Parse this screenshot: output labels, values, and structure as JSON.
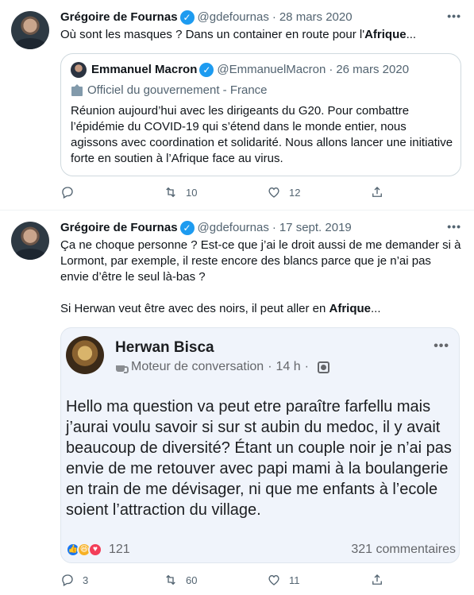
{
  "colors": {
    "accent": "#1d9bf0",
    "muted": "#536471",
    "border": "#cfd9de",
    "fb_card_bg": "#f0f4fb"
  },
  "tweet1": {
    "author_name": "Grégoire de Fournas",
    "handle": "@gdefournas",
    "separator": "·",
    "date": "28 mars 2020",
    "text_prefix": "Où sont les masques ? Dans un container en route pour l'",
    "text_bold": "Afrique",
    "text_suffix": "...",
    "quote": {
      "author_name": "Emmanuel Macron",
      "handle": "@EmmanuelMacron",
      "separator": "·",
      "date": "26 mars 2020",
      "label": "Officiel du gouvernement - France",
      "text": "Réunion aujourd’hui avec les dirigeants du G20. Pour combattre l’épidémie du COVID-19 qui s’étend dans le monde entier, nous agissons avec coordination et solidarité. Nous allons lancer une initiative forte en soutien à l’Afrique face au virus."
    },
    "actions": {
      "replies": "",
      "retweets": "10",
      "likes": "12"
    }
  },
  "tweet2": {
    "author_name": "Grégoire de Fournas",
    "handle": "@gdefournas",
    "separator": "·",
    "date": "17 sept. 2019",
    "text_p1": "Ça ne choque personne ? Est-ce que j’ai le droit aussi de me demander si à Lormont, par exemple, il reste encore des blancs parce que je n’ai pas envie d’être le seul là-bas ?",
    "text_p2_prefix": "Si Herwan veut être avec des noirs, il peut aller en ",
    "text_p2_bold": "Afrique",
    "text_p2_suffix": "...",
    "embed": {
      "author_name": "Herwan Bisca",
      "group": "Moteur de conversation",
      "separator": "·",
      "time": "14 h",
      "separator2": "·",
      "body": "Hello ma question va peut etre paraître farfellu mais j’aurai voulu savoir si sur st aubin du medoc, il y avait beaucoup de diversité? Étant un couple noir je n’ai pas envie de me retouver avec papi mami à la boulangerie en train de me dévisager, ni que me enfants à l’ecole soient l’attraction du village.",
      "reactions_count": "121",
      "comments": "321 commentaires"
    },
    "actions": {
      "replies": "3",
      "retweets": "60",
      "likes": "11"
    }
  }
}
